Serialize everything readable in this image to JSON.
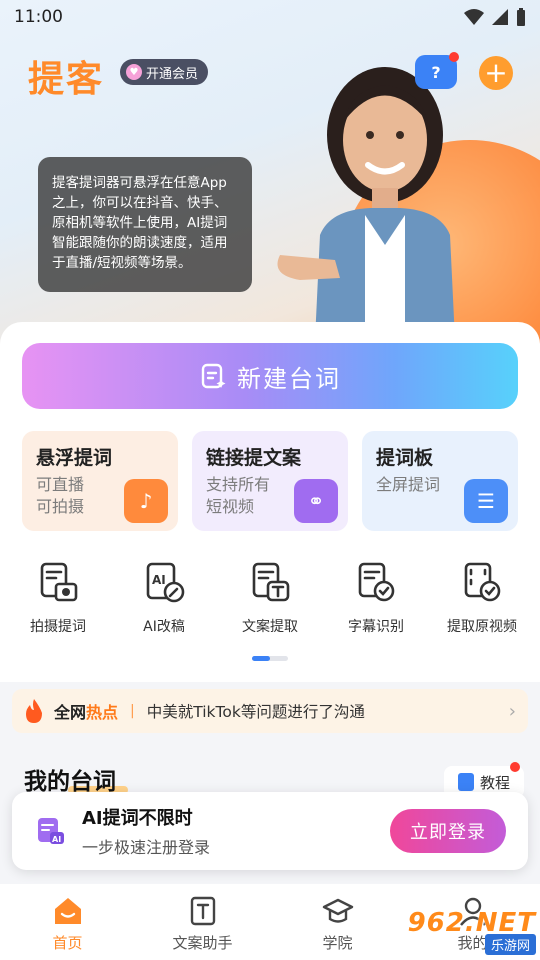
{
  "status_bar": {
    "time": "11:00"
  },
  "header": {
    "logo": "提客",
    "vip_label": "开通会员"
  },
  "hero": {
    "tip_text": "提客提词器可悬浮在任意App之上，你可以在抖音、快手、原相机等软件上使用，AI提词智能跟随你的朗读速度，适用于直播/短视频等场景。"
  },
  "main": {
    "new_button_label": "新建台词",
    "cards": [
      {
        "title": "悬浮提词",
        "sub1": "可直播",
        "sub2": "可拍摄"
      },
      {
        "title": "链接提文案",
        "sub1": "支持所有",
        "sub2": "短视频"
      },
      {
        "title": "提词板",
        "sub1": "全屏提词",
        "sub2": ""
      }
    ],
    "tools": [
      {
        "label": "拍摄提词",
        "icon": "camera-script-icon"
      },
      {
        "label": "AI改稿",
        "icon": "ai-edit-icon"
      },
      {
        "label": "文案提取",
        "icon": "text-extract-icon"
      },
      {
        "label": "字幕识别",
        "icon": "subtitle-recognize-icon"
      },
      {
        "label": "提取原视频",
        "icon": "video-extract-icon"
      }
    ]
  },
  "hot": {
    "label_a": "全网",
    "label_b": "热点",
    "separator": "|",
    "headline": "中美就TikTok等问题进行了沟通"
  },
  "my_lines": {
    "title": "我的台词",
    "tutorial_label": "教程"
  },
  "login_banner": {
    "title": "AI提词不限时",
    "subtitle": "一步极速注册登录",
    "button": "立即登录"
  },
  "nav": [
    {
      "label": "首页",
      "active": true
    },
    {
      "label": "文案助手",
      "active": false
    },
    {
      "label": "学院",
      "active": false
    },
    {
      "label": "我的",
      "active": false
    }
  ],
  "watermark": {
    "top": "962.NET",
    "bottom": "乐游网"
  },
  "colors": {
    "accent": "#ff8a2a",
    "primary_blue": "#3b82f6",
    "login_pink": "#f0479a"
  }
}
